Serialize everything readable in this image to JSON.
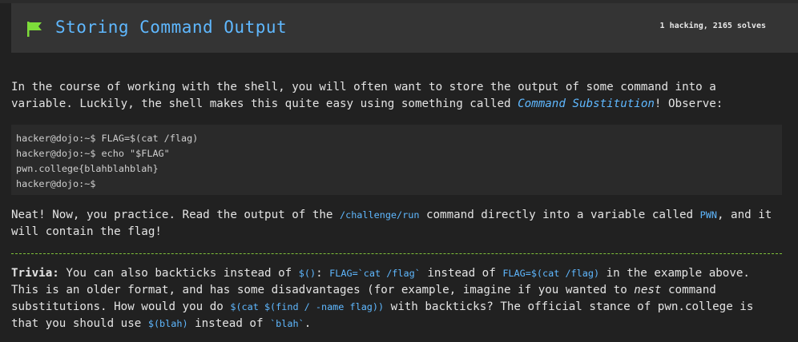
{
  "header": {
    "title": "Storing Command Output",
    "stats": "1 hacking, 2165 solves",
    "flag_color": "#7ddc3a",
    "title_color": "#5fb8ff"
  },
  "intro": {
    "text_before": "In the course of working with the shell, you will often want to store the output of some command into a variable. Luckily, the shell makes this quite easy using something called ",
    "link": "Command Substitution",
    "text_after": "! Observe:"
  },
  "code_example": {
    "lines": [
      "hacker@dojo:~$ FLAG=$(cat /flag)",
      "hacker@dojo:~$ echo \"$FLAG\"",
      "pwn.college{blahblahblah}",
      "hacker@dojo:~$"
    ]
  },
  "task": {
    "t1": "Neat! Now, you practice. Read the output of the ",
    "c1": "/challenge/run",
    "t2": " command directly into a variable called ",
    "c2": "PWN",
    "t3": ", and it will contain the flag!"
  },
  "trivia": {
    "label": "Trivia:",
    "t1": " You can also backticks instead of ",
    "c1": "$()",
    "t2": ": ",
    "c2": "FLAG=`cat /flag`",
    "t3": " instead of ",
    "c3": "FLAG=$(cat /flag)",
    "t4": " in the example above. This is an older format, and has some disadvantages (for example, imagine if you wanted to ",
    "em1": "nest",
    "t5": " command substitutions. How would you do ",
    "c4": "$(cat $(find / -name flag))",
    "t6": " with backticks? The official stance of pwn.college is that you should use ",
    "c5": "$(blah)",
    "t7": " instead of ",
    "c6": "`blah`",
    "t8": "."
  }
}
